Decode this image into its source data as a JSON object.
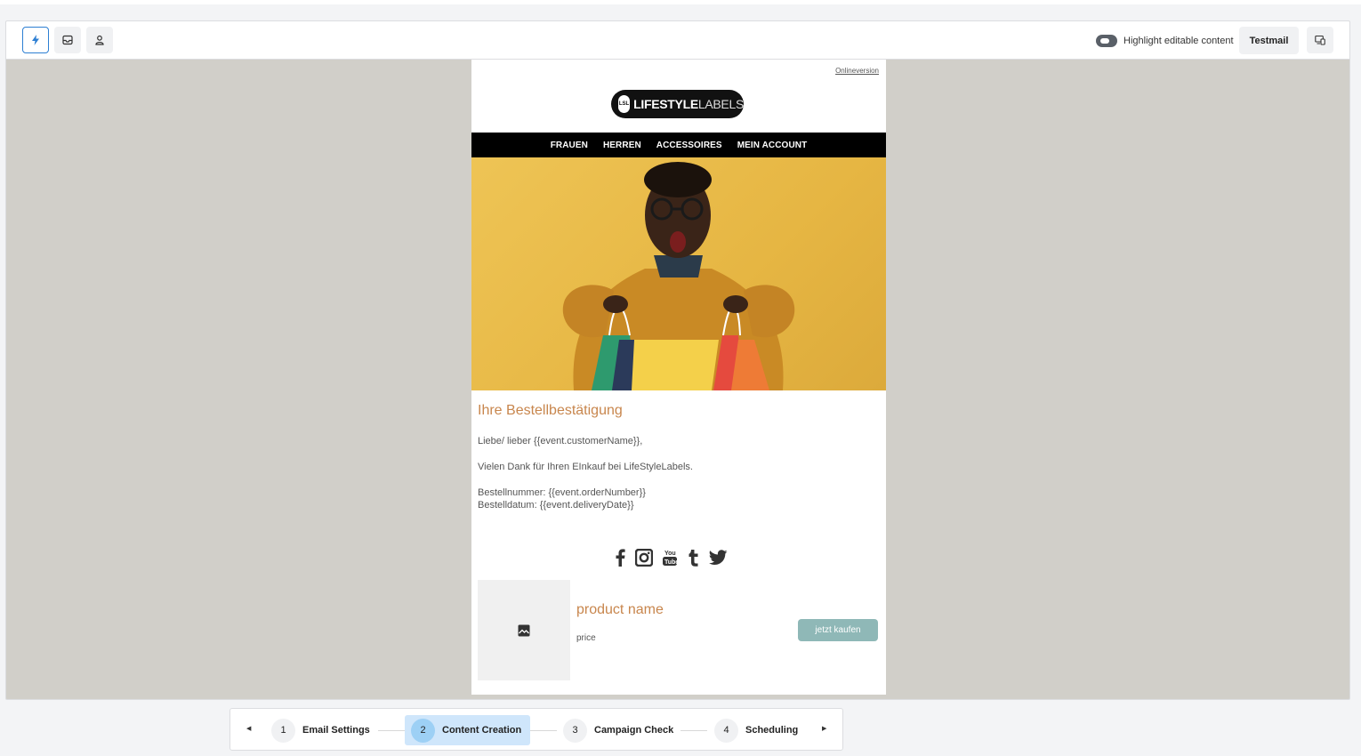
{
  "toolbar": {
    "icons": [
      "lightning-icon",
      "inbox-icon",
      "user-icon"
    ],
    "highlight_label": "Highlight editable content",
    "testmail_label": "Testmail",
    "device_icon": "device-preview-icon"
  },
  "email": {
    "online_version": "Onlineversion",
    "logo": {
      "mark": "LSL",
      "text_bold": "LIFESTYLE",
      "text_light": "LABELS"
    },
    "nav": [
      "FRAUEN",
      "HERREN",
      "ACCESSOIRES",
      "MEIN ACCOUNT"
    ],
    "heading": "Ihre Bestellbestätigung",
    "greeting": "Liebe/ lieber {{event.customerName}},",
    "thanks": "Vielen Dank für Ihren EInkauf bei LifeStyleLabels.",
    "order_number": "Bestellnummer: {{event.orderNumber}}",
    "order_date": "Bestelldatum: {{event.deliveryDate}}",
    "social_icons": [
      "facebook-icon",
      "instagram-icon",
      "youtube-icon",
      "tumblr-icon",
      "twitter-icon"
    ],
    "product": {
      "name": "product name",
      "price": "price",
      "button": "jetzt kaufen"
    },
    "colors": {
      "accent": "#c8864d",
      "button": "#8fb8b7",
      "hero": "#e6b643"
    }
  },
  "stepper": {
    "steps": [
      {
        "num": "1",
        "label": "Email Settings"
      },
      {
        "num": "2",
        "label": "Content Creation"
      },
      {
        "num": "3",
        "label": "Campaign Check"
      },
      {
        "num": "4",
        "label": "Scheduling"
      }
    ],
    "active": "2"
  }
}
